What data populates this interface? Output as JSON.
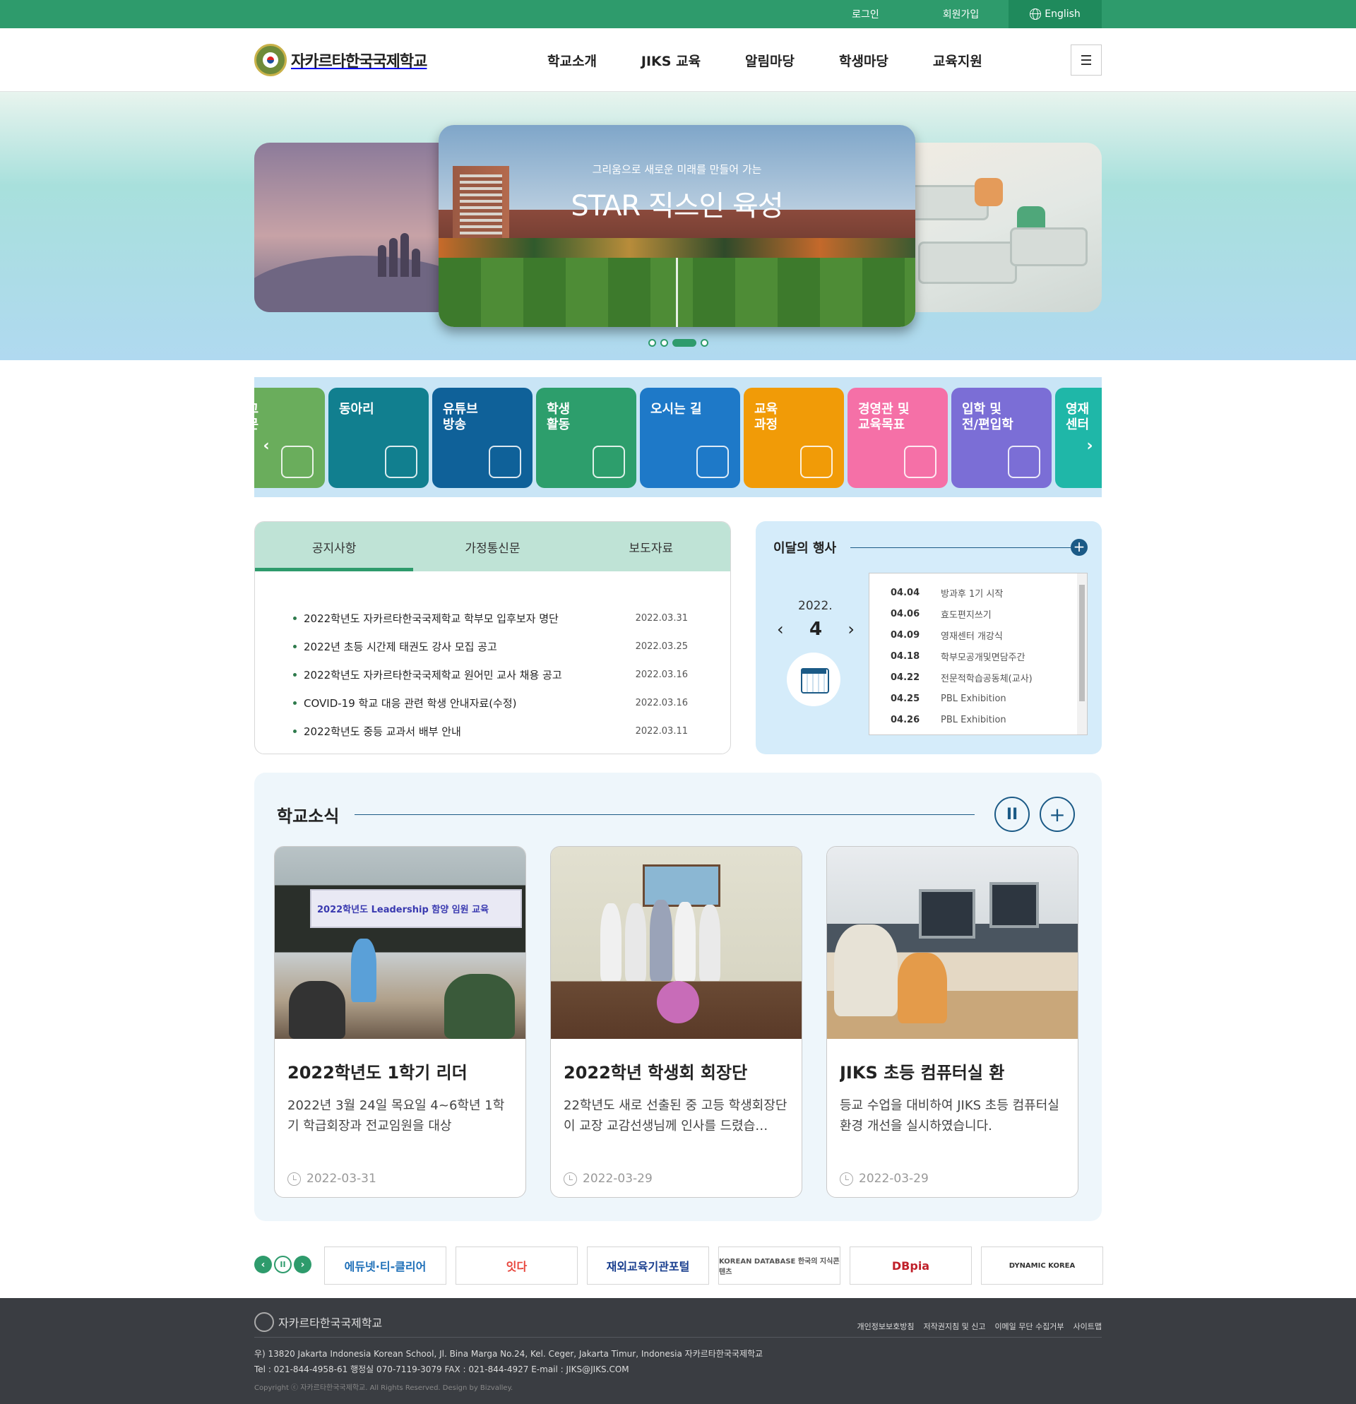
{
  "topbar": {
    "login": "로그인",
    "join": "회원가입",
    "english": "English"
  },
  "header": {
    "logo_text": "자카르타한국국제학교",
    "nav": [
      "학교소개",
      "JIKS 교육",
      "알림마당",
      "학생마당",
      "교육지원"
    ]
  },
  "hero": {
    "subtitle": "그리움으로 새로운 미래를 만들어 가는",
    "title": "STAR 직스인 육성",
    "slide_count": 4,
    "active_slide": 3
  },
  "quick_menu": {
    "items": [
      {
        "label": "학교\n신문",
        "color": "#6aad5c",
        "icon": "book-reader-icon"
      },
      {
        "label": "동아리",
        "color": "#117f8f",
        "icon": "network-icon"
      },
      {
        "label": "유튜브\n방송",
        "color": "#0f6199",
        "icon": "video-icon"
      },
      {
        "label": "학생\n활동",
        "color": "#2d9e6c",
        "icon": "idea-board-icon"
      },
      {
        "label": "오시는 길",
        "color": "#1e79c8",
        "icon": "map-pin-icon"
      },
      {
        "label": "교육\n과정",
        "color": "#f19b07",
        "icon": "graduation-icon"
      },
      {
        "label": "경영관 및\n교육목표",
        "color": "#f570a7",
        "icon": "teacher-board-icon"
      },
      {
        "label": "입학 및\n전/편입학",
        "color": "#7b6ed6",
        "icon": "school-icon"
      },
      {
        "label": "영재\n센터",
        "color": "#1fb7a8",
        "icon": "star-icon"
      }
    ]
  },
  "notice": {
    "tabs": [
      "공지사항",
      "가정통신문",
      "보도자료"
    ],
    "active_tab": 0,
    "items": [
      {
        "title": "2022학년도 자카르타한국국제학교 학부모 입후보자 명단",
        "date": "2022.03.31"
      },
      {
        "title": "2022년 초등 시간제 태권도 강사 모집 공고",
        "date": "2022.03.25"
      },
      {
        "title": "2022학년도 자카르타한국국제학교 원어민 교사 채용 공고",
        "date": "2022.03.16"
      },
      {
        "title": "COVID-19 학교 대응 관련 학생 안내자료(수정)",
        "date": "2022.03.16"
      },
      {
        "title": "2022학년도 중등 교과서 배부 안내",
        "date": "2022.03.11"
      }
    ]
  },
  "events": {
    "title": "이달의 행사",
    "plus": "+",
    "year": "2022.",
    "month": "4",
    "prev": "‹",
    "next": "›",
    "items": [
      {
        "date": "04.04",
        "name": "방과후 1기 시작"
      },
      {
        "date": "04.06",
        "name": "효도편지쓰기"
      },
      {
        "date": "04.09",
        "name": "영재센터 개강식"
      },
      {
        "date": "04.18",
        "name": "학부모공개및면담주간"
      },
      {
        "date": "04.22",
        "name": "전문적학습공동체(교사)"
      },
      {
        "date": "04.25",
        "name": "PBL Exhibition"
      },
      {
        "date": "04.26",
        "name": "PBL Exhibition"
      }
    ]
  },
  "news": {
    "title": "학교소식",
    "pause": "II",
    "more": "+",
    "cards": [
      {
        "title": "2022학년도 1학기 리더",
        "desc": "2022년 3월 24일 목요일  4~6학년 1학기 학급회장과 전교임원을 대상",
        "date": "2022-03-31"
      },
      {
        "title": "2022학년 학생회 회장단",
        "desc": "22학년도 새로 선출된 중 고등 학생회장단이 교장 교감선생님께 인사를 드렸습…",
        "date": "2022-03-29"
      },
      {
        "title": "JIKS 초등 컴퓨터실 환",
        "desc": " 등교 수업을 대비하여 JIKS 초등 컴퓨터실 환경 개선을 실시하였습니다.",
        "date": "2022-03-29"
      }
    ],
    "img1_banner": "2022학년도 Leadership 함양 임원 교육"
  },
  "banners": {
    "prev": "‹",
    "pause": "II",
    "next": "›",
    "items": [
      {
        "label": "에듀넷·티-클리어",
        "color": "#1d6fb8"
      },
      {
        "label": "잇다",
        "color": "#e8453c"
      },
      {
        "label": "재외교육기관포털",
        "color": "#1a3f8f"
      },
      {
        "label": "KOREAN DATABASE 한국의 지식콘텐츠",
        "color": "#555555"
      },
      {
        "label": "DBpia",
        "color": "#c0202a"
      },
      {
        "label": "DYNAMIC KOREA",
        "color": "#333333"
      }
    ]
  },
  "footer": {
    "logo_text": "자카르타한국국제학교",
    "links": [
      "개인정보보호방침",
      "저작권지침 및 신고",
      "이메일 무단 수집거부",
      "사이트맵"
    ],
    "address": "우) 13820 Jakarta Indonesia Korean School, Jl. Bina Marga No.24, Kel. Ceger, Jakarta Timur, Indonesia 자카르타한국국제학교",
    "contact": "Tel : 021-844-4958-61 행정실 070-7119-3079   FAX : 021-844-4927   E-mail : JIKS@JIKS.COM",
    "copyright": "Copyright ⓒ 자카르타한국국제학교. All Rights Reserved. Design by Bizvalley."
  },
  "colors": {
    "brand_green": "#2e9b6c",
    "navy": "#1b5a86",
    "footer_bg": "#3a3d42"
  }
}
